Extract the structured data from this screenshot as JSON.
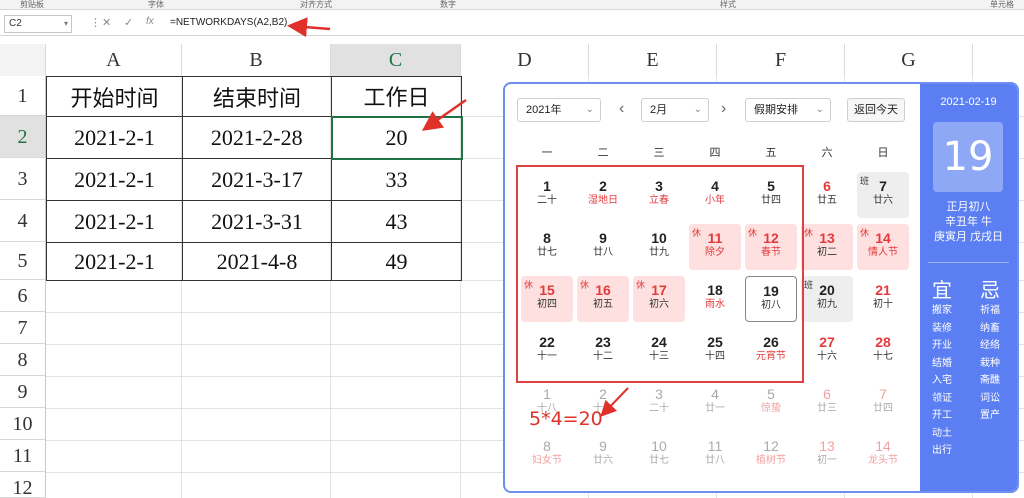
{
  "ribbon": {
    "groups": [
      "剪贴板",
      "字体",
      "对齐方式",
      "数字",
      "样式",
      "单元格"
    ]
  },
  "formula_bar": {
    "cell_ref": "C2",
    "formula": "=NETWORKDAYS(A2,B2)",
    "cancel": "✕",
    "confirm": "✓",
    "fx": "fx"
  },
  "columns": [
    "A",
    "B",
    "C",
    "D",
    "E",
    "F",
    "G"
  ],
  "rows": [
    "1",
    "2",
    "3",
    "4",
    "5",
    "6",
    "7",
    "8",
    "9",
    "10",
    "11",
    "12"
  ],
  "table": {
    "headers": [
      "开始时间",
      "结束时间",
      "工作日"
    ],
    "rows": [
      [
        "2021-2-1",
        "2021-2-28",
        "20"
      ],
      [
        "2021-2-1",
        "2021-3-17",
        "33"
      ],
      [
        "2021-2-1",
        "2021-3-31",
        "43"
      ],
      [
        "2021-2-1",
        "2021-4-8",
        "49"
      ]
    ]
  },
  "calendar": {
    "year_select": "2021年",
    "month_select": "2月",
    "holiday_select": "假期安排",
    "today_button": "返回今天",
    "prev": "‹",
    "next": "›",
    "weekdays": [
      "一",
      "二",
      "三",
      "四",
      "五",
      "六",
      "日"
    ],
    "side": {
      "date": "2021-02-19",
      "day": "19",
      "lunar": "正月初八",
      "year_gz": "辛丑年 牛",
      "month_day_gz": "庚寅月 戊戌日",
      "yi_title": "宜",
      "ji_title": "忌",
      "yi": [
        "搬家",
        "装修",
        "开业",
        "结婚",
        "入宅",
        "领证",
        "开工",
        "动土",
        "出行"
      ],
      "ji": [
        "祈福",
        "纳畜",
        "经络",
        "栽种",
        "斋醮",
        "词讼",
        "置产"
      ]
    },
    "weeks": [
      [
        {
          "n": "1",
          "l": "二十"
        },
        {
          "n": "2",
          "l": "湿地日",
          "k": "fest"
        },
        {
          "n": "3",
          "l": "立春",
          "k": "fest"
        },
        {
          "n": "4",
          "l": "小年",
          "k": "fest"
        },
        {
          "n": "5",
          "l": "廿四"
        },
        {
          "n": "6",
          "l": "廿五",
          "k": "we"
        },
        {
          "n": "7",
          "l": "廿六",
          "k": "work",
          "t": "班"
        }
      ],
      [
        {
          "n": "8",
          "l": "廿七"
        },
        {
          "n": "9",
          "l": "廿八"
        },
        {
          "n": "10",
          "l": "廿九"
        },
        {
          "n": "11",
          "l": "除夕",
          "k": "hol fest",
          "t": "休"
        },
        {
          "n": "12",
          "l": "春节",
          "k": "hol fest",
          "t": "休"
        },
        {
          "n": "13",
          "l": "初二",
          "k": "hol",
          "t": "休"
        },
        {
          "n": "14",
          "l": "情人节",
          "k": "hol fest",
          "t": "休"
        }
      ],
      [
        {
          "n": "15",
          "l": "初四",
          "k": "hol",
          "t": "休"
        },
        {
          "n": "16",
          "l": "初五",
          "k": "hol",
          "t": "休"
        },
        {
          "n": "17",
          "l": "初六",
          "k": "hol",
          "t": "休"
        },
        {
          "n": "18",
          "l": "雨水",
          "k": "fest"
        },
        {
          "n": "19",
          "l": "初八",
          "k": "today"
        },
        {
          "n": "20",
          "l": "初九",
          "k": "work",
          "t": "班"
        },
        {
          "n": "21",
          "l": "初十",
          "k": "we"
        }
      ],
      [
        {
          "n": "22",
          "l": "十一"
        },
        {
          "n": "23",
          "l": "十二"
        },
        {
          "n": "24",
          "l": "十三"
        },
        {
          "n": "25",
          "l": "十四"
        },
        {
          "n": "26",
          "l": "元宵节",
          "k": "fest"
        },
        {
          "n": "27",
          "l": "十六",
          "k": "we"
        },
        {
          "n": "28",
          "l": "十七",
          "k": "we"
        }
      ],
      [
        {
          "n": "1",
          "l": "十八",
          "k": "other"
        },
        {
          "n": "2",
          "l": "十九",
          "k": "other"
        },
        {
          "n": "3",
          "l": "二十",
          "k": "other"
        },
        {
          "n": "4",
          "l": "廿一",
          "k": "other"
        },
        {
          "n": "5",
          "l": "惊蛰",
          "k": "other fest"
        },
        {
          "n": "6",
          "l": "廿三",
          "k": "other we"
        },
        {
          "n": "7",
          "l": "廿四",
          "k": "other we"
        }
      ],
      [
        {
          "n": "8",
          "l": "妇女节",
          "k": "other fest"
        },
        {
          "n": "9",
          "l": "廿六",
          "k": "other"
        },
        {
          "n": "10",
          "l": "廿七",
          "k": "other"
        },
        {
          "n": "11",
          "l": "廿八",
          "k": "other"
        },
        {
          "n": "12",
          "l": "植树节",
          "k": "other fest"
        },
        {
          "n": "13",
          "l": "初一",
          "k": "other we"
        },
        {
          "n": "14",
          "l": "龙头节",
          "k": "other we fest"
        }
      ]
    ],
    "annotation": "5*4=20"
  }
}
